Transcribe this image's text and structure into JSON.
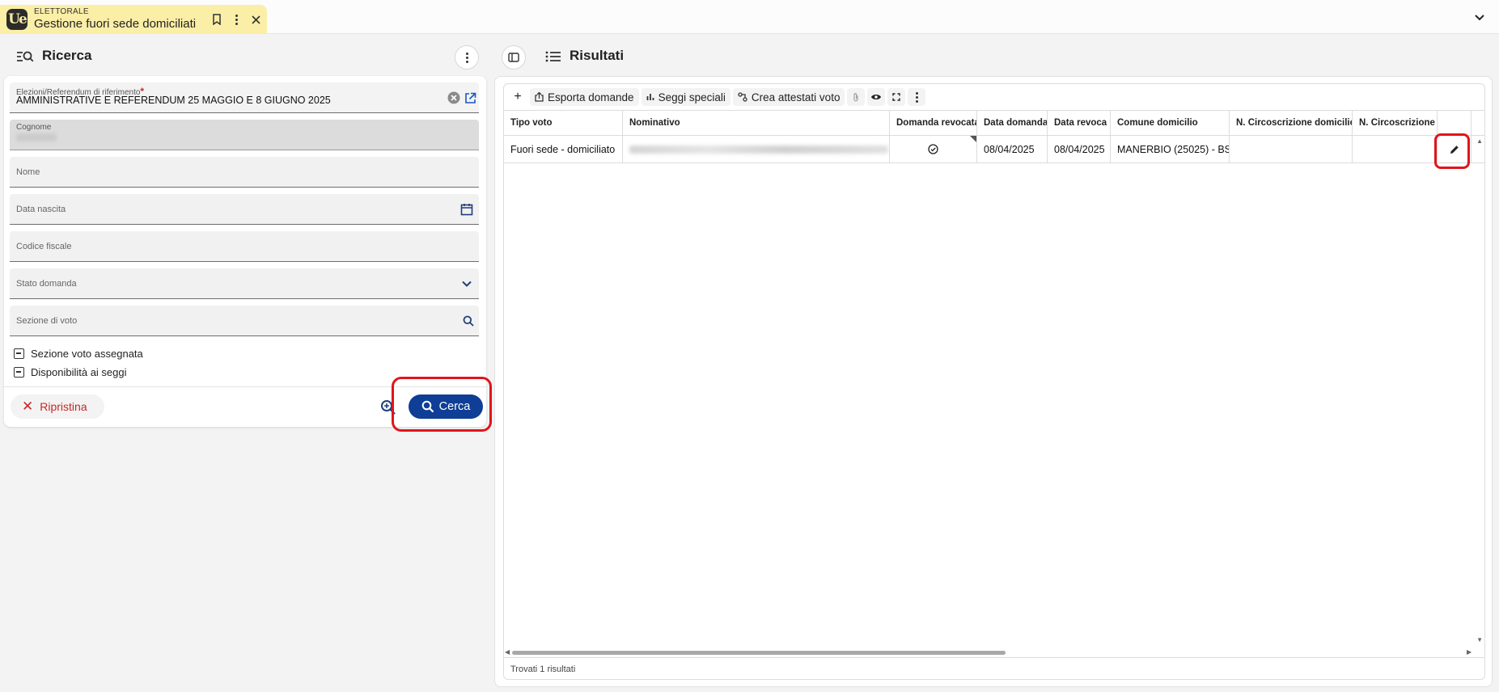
{
  "app": {
    "module": "ELETTORALE",
    "title": "Gestione fuori sede domiciliati",
    "logo_text": "Ue"
  },
  "search_panel": {
    "title": "Ricerca",
    "fields": {
      "elezioni": {
        "label": "Elezioni/Referendum di riferimento",
        "required_mark": "*",
        "value": "AMMINISTRATIVE E REFERENDUM 25 MAGGIO E 8 GIUGNO 2025"
      },
      "cognome": {
        "label": "Cognome",
        "value": ""
      },
      "nome": {
        "label": "Nome"
      },
      "data_nascita": {
        "label": "Data nascita"
      },
      "codice_fiscale": {
        "label": "Codice fiscale"
      },
      "stato_domanda": {
        "label": "Stato domanda"
      },
      "sezione_voto": {
        "label": "Sezione di voto"
      }
    },
    "checkboxes": [
      {
        "label": "Sezione voto assegnata"
      },
      {
        "label": "Disponibilità ai seggi"
      }
    ],
    "reset_label": "Ripristina",
    "search_label": "Cerca"
  },
  "results_panel": {
    "title": "Risultati",
    "toolbar": {
      "export_label": "Esporta domande",
      "special_seats_label": "Seggi speciali",
      "certificates_label": "Crea attestati voto"
    },
    "columns": [
      "Tipo voto",
      "Nominativo",
      "Domanda revocata",
      "Data domanda",
      "Data revoca",
      "Comune domicilio",
      "N. Circoscrizione domicilio",
      "N. Circoscrizione r"
    ],
    "rows": [
      {
        "tipo_voto": "Fuori sede - domiciliato",
        "nominativo": "",
        "domanda_revocata": true,
        "data_domanda": "08/04/2025",
        "data_revoca": "08/04/2025",
        "comune_domicilio": "MANERBIO (25025) - BS",
        "circ_domicilio": "",
        "circ_r": ""
      }
    ],
    "footer": "Trovati 1 risultati"
  },
  "colors": {
    "accent": "#0e3e96",
    "danger": "#c62828",
    "tab_bg": "#fbeea7",
    "highlight": "#e0151b"
  }
}
